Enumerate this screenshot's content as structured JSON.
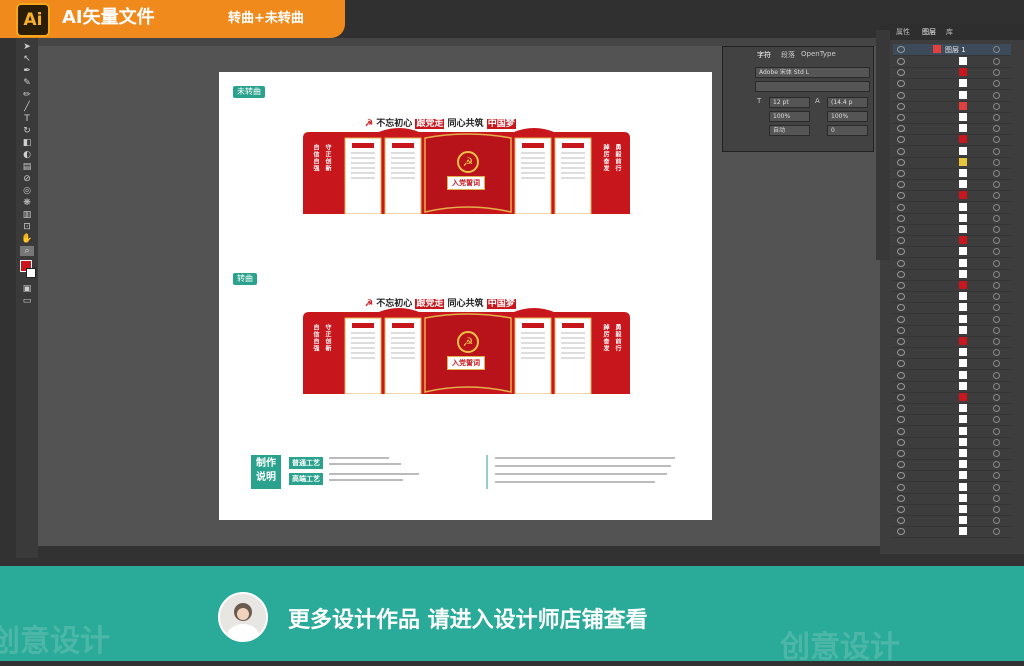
{
  "badge": {
    "logo": "Ai",
    "title": "AI矢量文件",
    "subtitle": "转曲+未转曲"
  },
  "artboard": {
    "tag_top": "未转曲",
    "tag_bottom": "转曲",
    "board_title_a": "不忘初心",
    "board_title_b": "跟党走",
    "board_title_c": "同心共筑",
    "board_title_d": "中国梦",
    "center_ribbon": "入党誓词",
    "left_vertical_1": "自信自强",
    "left_vertical_2": "守正创新",
    "right_vertical_1": "踔厉奋发",
    "right_vertical_2": "勇毅前行",
    "notes": {
      "heading": "制作说明",
      "normal_label": "普通工艺",
      "premium_label": "高端工艺"
    }
  },
  "char_panel": {
    "tabs": [
      "字符",
      "段落",
      "OpenType"
    ],
    "font_family": "Adobe 宋体 Std L",
    "font_size": "12 pt",
    "leading": "(14.4 p",
    "scale_v": "100%",
    "scale_h": "100%",
    "kerning": "自动",
    "tracking": "0"
  },
  "right_panel": {
    "tabs": [
      "属性",
      "图层",
      "库"
    ],
    "layer_name": "图层 1"
  },
  "bottom": {
    "cta": "更多设计作品 请进入设计师店铺查看",
    "watermark": "创意设计"
  },
  "colors": {
    "accent": "#f08a1c",
    "teal": "#2aaa98",
    "party_red": "#c8161d",
    "gold": "#e3b04b"
  }
}
